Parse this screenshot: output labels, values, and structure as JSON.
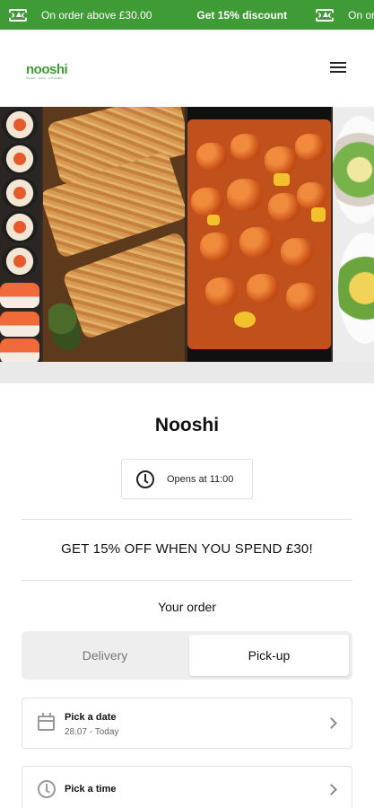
{
  "promo": {
    "left_text": "On order above £30.00",
    "center_text": "Get 15% discount",
    "right_text": "On order above",
    "icons": [
      "ticket-icon",
      "ticket-icon"
    ]
  },
  "header": {
    "logo_text": "nooshi",
    "logo_sub": "SUSHI · ASIA · KITCHEN",
    "menu_icon": "hamburger-icon"
  },
  "hero": {
    "images": [
      "sushi-image",
      "katsu-chicken-image",
      "sweet-and-sour-chicken-image",
      "salad-bowl-image"
    ]
  },
  "store": {
    "name": "Nooshi",
    "hours_label": "Opens at 11:00"
  },
  "offer": {
    "text": "GET 15% OFF WHEN YOU SPEND £30!"
  },
  "order": {
    "title": "Your order",
    "options": [
      "Delivery",
      "Pick-up"
    ],
    "selected": "Pick-up",
    "date": {
      "title": "Pick a date",
      "value": "28.07 - Today"
    },
    "time": {
      "title": "Pick a time"
    }
  },
  "colors": {
    "brand_green": "#3f9b36",
    "toggle_bg": "#eeeeee",
    "divider": "#e2e2e2"
  }
}
